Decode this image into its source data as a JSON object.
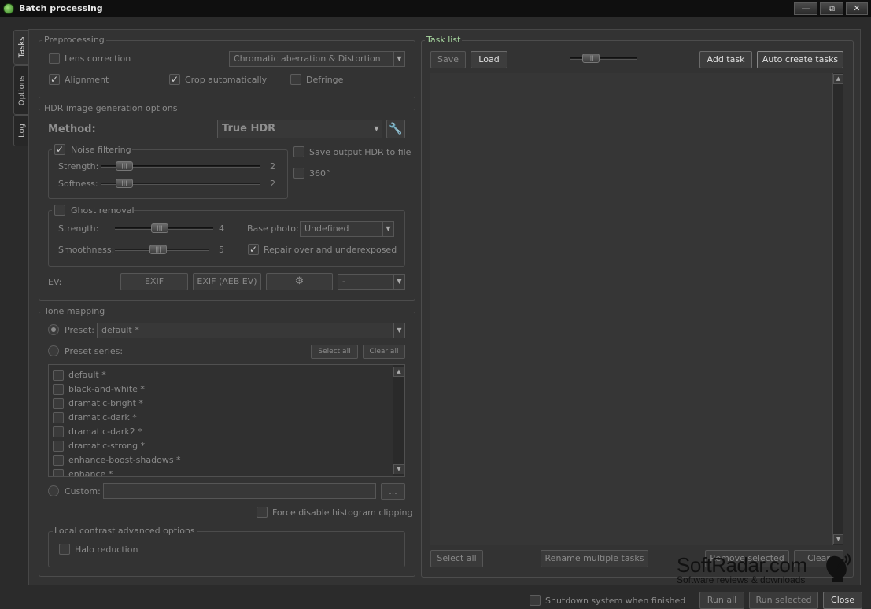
{
  "window": {
    "title": "Batch processing",
    "btn_minimize": "—",
    "btn_restore": "⧉",
    "btn_close": "✕"
  },
  "tabs": [
    "Tasks",
    "Options",
    "Log"
  ],
  "preprocessing": {
    "title": "Preprocessing",
    "lens_correction": "Lens correction",
    "lens_option": "Chromatic aberration & Distortion",
    "alignment": "Alignment",
    "crop": "Crop automatically",
    "defringe": "Defringe"
  },
  "hdr": {
    "title": "HDR image generation options",
    "method_label": "Method:",
    "method_value": "True HDR",
    "noise_filtering": "Noise filtering",
    "strength_label": "Strength:",
    "strength_value": "2",
    "softness_label": "Softness:",
    "softness_value": "2",
    "save_output": "Save output HDR to file",
    "opt_360": "360°",
    "ghost_removal": "Ghost removal",
    "ghost_strength_label": "Strength:",
    "ghost_strength_value": "4",
    "smoothness_label": "Smoothness:",
    "smoothness_value": "5",
    "base_photo_label": "Base photo:",
    "base_photo_value": "Undefined",
    "repair": "Repair over and underexposed",
    "ev_label": "EV:",
    "exif": "EXIF",
    "exif_aeb": "EXIF (AEB EV)",
    "ev_value": "-"
  },
  "tone": {
    "title": "Tone mapping",
    "preset_label": "Preset:",
    "preset_value": "default *",
    "preset_series": "Preset series:",
    "select_all": "Select all",
    "clear_all": "Clear all",
    "presets": [
      "default *",
      "black-and-white *",
      "dramatic-bright *",
      "dramatic-dark *",
      "dramatic-dark2 *",
      "dramatic-strong *",
      "enhance-boost-shadows *",
      "enhance *"
    ],
    "custom_label": "Custom:",
    "browse": "...",
    "force_disable": "Force disable histogram clipping",
    "local_contrast": "Local contrast advanced options",
    "halo": "Halo reduction"
  },
  "tasklist": {
    "title": "Task list",
    "save": "Save",
    "load": "Load",
    "add_task": "Add task",
    "auto_create": "Auto create tasks",
    "select_all": "Select all",
    "rename_multiple": "Rename multiple tasks",
    "remove_selected": "Remove selected",
    "clear": "Clear"
  },
  "bottom": {
    "shutdown": "Shutdown system when finished",
    "run_all": "Run all",
    "run_selected": "Run selected",
    "close": "Close"
  },
  "watermark": {
    "main": "SoftRadar.com",
    "sub": "Software reviews & downloads"
  },
  "colors": {
    "background": "#2b2b2b",
    "titlebar": "#0f0f0f",
    "tasklist_label": "#a8d8a0"
  }
}
